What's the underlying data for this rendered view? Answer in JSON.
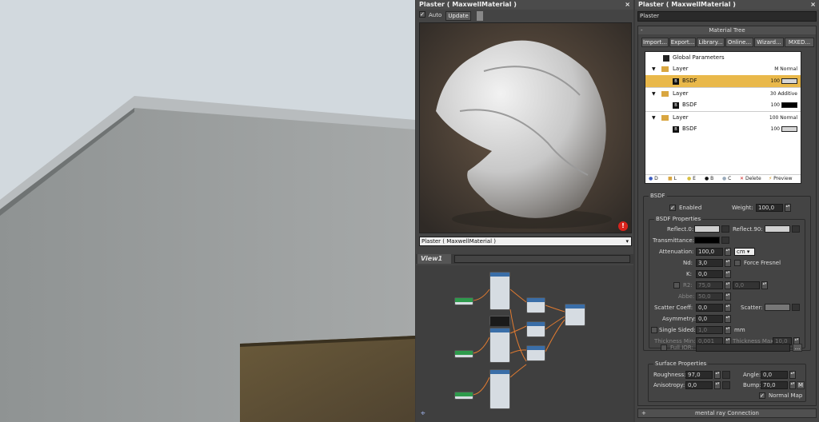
{
  "preview_panel": {
    "title": "Plaster  ( MaxwellMaterial )",
    "auto_label": "Auto",
    "update_label": "Update",
    "material_select": "Plaster  ( MaxwellMaterial )",
    "viewport_tab": "View1"
  },
  "editor_panel": {
    "title": "Plaster  ( MaxwellMaterial )",
    "name_field": "Plaster",
    "rollout_title": "Material Tree",
    "rollout_toggle": "-",
    "toolbar": [
      "Import...",
      "Export...",
      "Library...",
      "Online...",
      "Wizard...",
      "MXED..."
    ],
    "tree": {
      "global": "Global Parameters",
      "layers": [
        {
          "label": "Layer",
          "info": "M Normal",
          "bsdf": "BSDF",
          "weight": "100",
          "selected": true,
          "swatch": "#d6d6d6"
        },
        {
          "label": "Layer",
          "info": "30 Additive",
          "bsdf": "BSDF",
          "weight": "100",
          "selected": false,
          "swatch": "#000000"
        },
        {
          "label": "Layer",
          "info": "100 Normal",
          "bsdf": "BSDF",
          "weight": "100",
          "selected": false,
          "swatch": "#d6d6d6"
        }
      ],
      "footer": [
        "D",
        "L",
        "E",
        "B",
        "C",
        "Delete",
        "Preview"
      ]
    },
    "bsdf": {
      "group_label": "BSDF",
      "enabled_label": "Enabled",
      "weight_label": "Weight:",
      "weight_value": "100,0",
      "props_label": "BSDF Properties",
      "reflect0_label": "Reflect.0:",
      "reflect90_label": "Reflect.90:",
      "transmittance_label": "Transmittance:",
      "attenuation_label": "Attenuation:",
      "attenuation_value": "100,0",
      "attenuation_unit": "cm",
      "nd_label": "Nd:",
      "nd_value": "3,0",
      "force_fresnel_label": "Force Fresnel",
      "k_label": "K:",
      "k_value": "0,0",
      "r2_label": "R2:",
      "r2_value": "75,0",
      "r2_value2": "0,0",
      "abbe_label": "Abbe:",
      "abbe_value": "50,0",
      "scatter_coeff_label": "Scatter Coeff:",
      "scatter_coeff_value": "0,0",
      "scatter_label": "Scatter:",
      "asymmetry_label": "Asymmetry:",
      "asymmetry_value": "0,0",
      "single_sided_label": "Single Sided:",
      "single_sided_value": "1,0",
      "single_sided_unit": "mm",
      "thickness_min_label": "Thickness Min:",
      "thickness_min_value": "0,001",
      "thickness_max_label": "Thickness Max:",
      "thickness_max_value": "10,0",
      "full_ior_label": "Full IOR:",
      "full_ior_button": "..."
    },
    "surface": {
      "group_label": "Surface Properties",
      "roughness_label": "Roughness:",
      "roughness_value": "97,0",
      "angle_label": "Angle:",
      "angle_value": "0,0",
      "anisotropy_label": "Anisotropy:",
      "anisotropy_value": "0,0",
      "bump_label": "Bump:",
      "bump_value": "70,0",
      "bump_map_label": "M",
      "normal_map_label": "Normal Map"
    },
    "bottom_rollout": {
      "toggle": "+",
      "label": "mental ray Connection"
    }
  },
  "colors": {
    "selection": "#e9b84a",
    "error_badge": "#d8231c"
  }
}
